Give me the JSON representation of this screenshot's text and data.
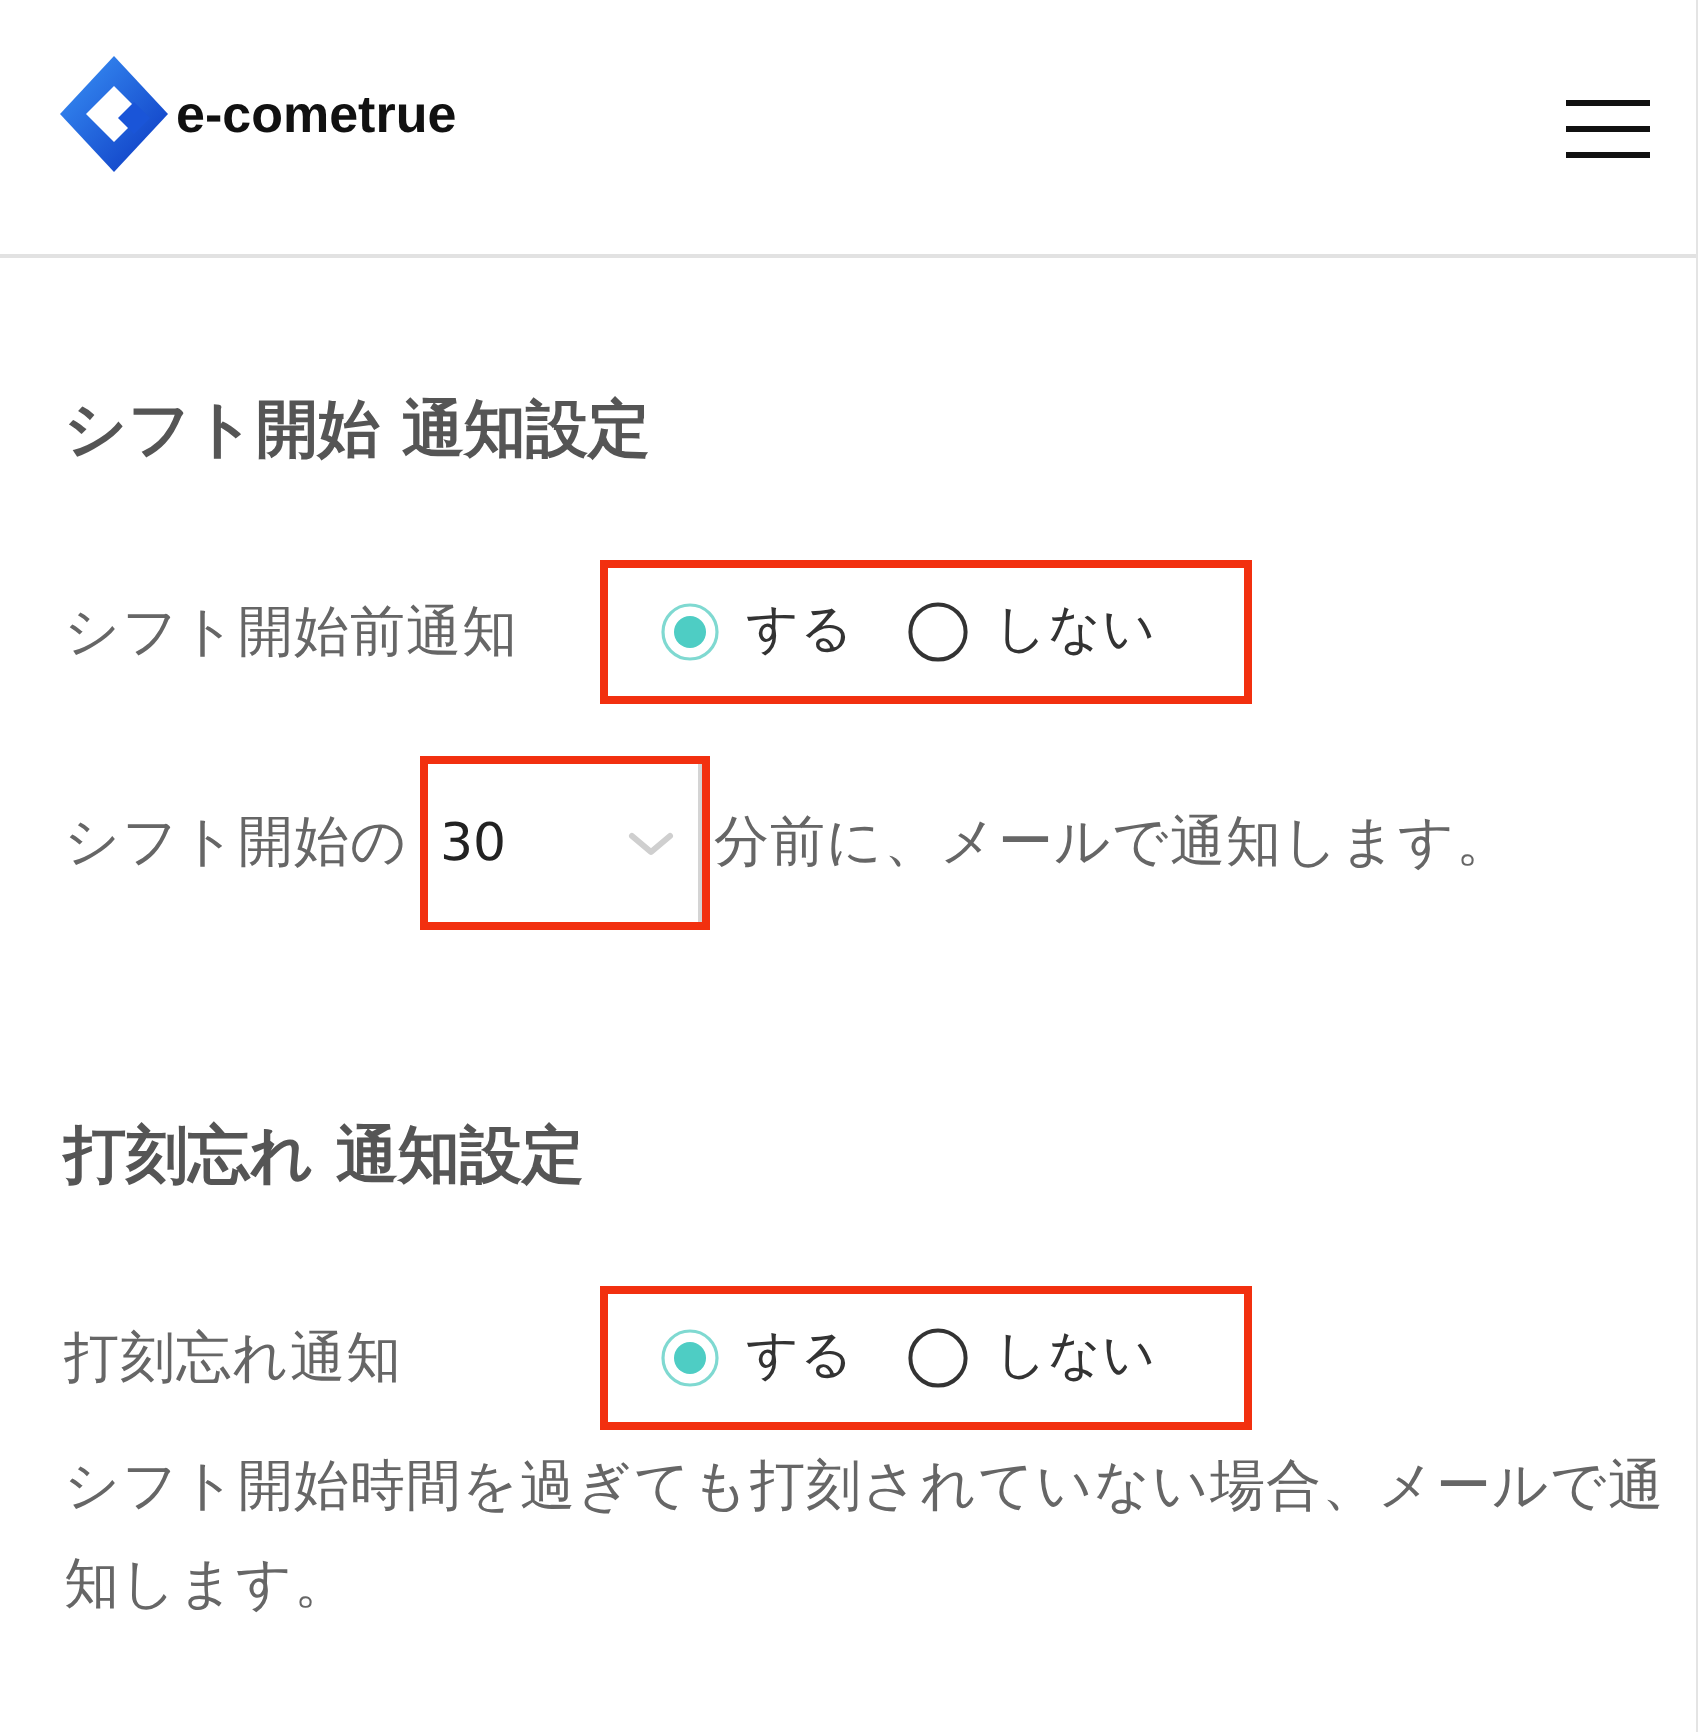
{
  "header": {
    "logo_text": "e-cometrue"
  },
  "sections": [
    {
      "heading": "シフト開始 通知設定",
      "rows": [
        {
          "kind": "radio",
          "label": "シフト開始前通知",
          "highlighted": true,
          "options": [
            {
              "label": "する",
              "selected": true
            },
            {
              "label": "しない",
              "selected": false
            }
          ]
        },
        {
          "kind": "select",
          "prefix": "シフト開始の",
          "value": "30",
          "suffix": "分前に、メールで通知します。",
          "highlighted": true
        }
      ]
    },
    {
      "heading": "打刻忘れ 通知設定",
      "rows": [
        {
          "kind": "radio",
          "label": "打刻忘れ通知",
          "highlighted": true,
          "options": [
            {
              "label": "する",
              "selected": true
            },
            {
              "label": "しない",
              "selected": false
            }
          ]
        },
        {
          "kind": "note",
          "text": "シフト開始時間を過ぎても打刻されていない場合、メールで通知します。"
        }
      ]
    }
  ]
}
